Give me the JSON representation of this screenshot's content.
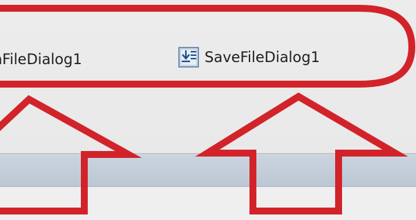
{
  "component_tray": {
    "components": [
      {
        "label": "nFileDialog1",
        "icon": "open-file-dialog-icon"
      },
      {
        "label": "SaveFileDialog1",
        "icon": "save-file-dialog-icon"
      }
    ]
  },
  "annotation": {
    "color": "#d2232a",
    "shapes": [
      "highlight-ellipse",
      "up-arrow-left",
      "up-arrow-right"
    ]
  }
}
